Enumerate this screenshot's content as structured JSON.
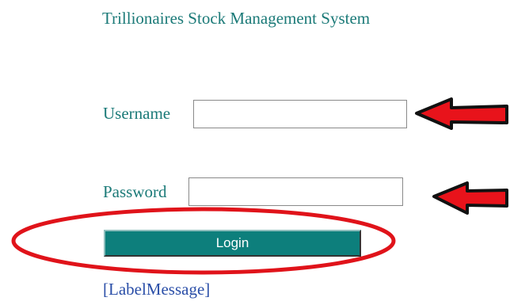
{
  "app": {
    "title": "Trillionaires Stock Management System"
  },
  "form": {
    "username_label": "Username",
    "username_value": "",
    "password_label": "Password",
    "password_value": "",
    "login_label": "Login",
    "message": "[LabelMessage]"
  },
  "annotations": {
    "arrow_icon": "left-arrow-icon",
    "ellipse_icon": "highlight-ellipse",
    "arrow_fill": "#e8131b",
    "arrow_outline": "#111111",
    "ellipse_color": "#e0131a"
  },
  "colors": {
    "accent_text": "#1b7a78",
    "button_bg": "#0d7f7c",
    "message_link": "#2b4fa8"
  }
}
